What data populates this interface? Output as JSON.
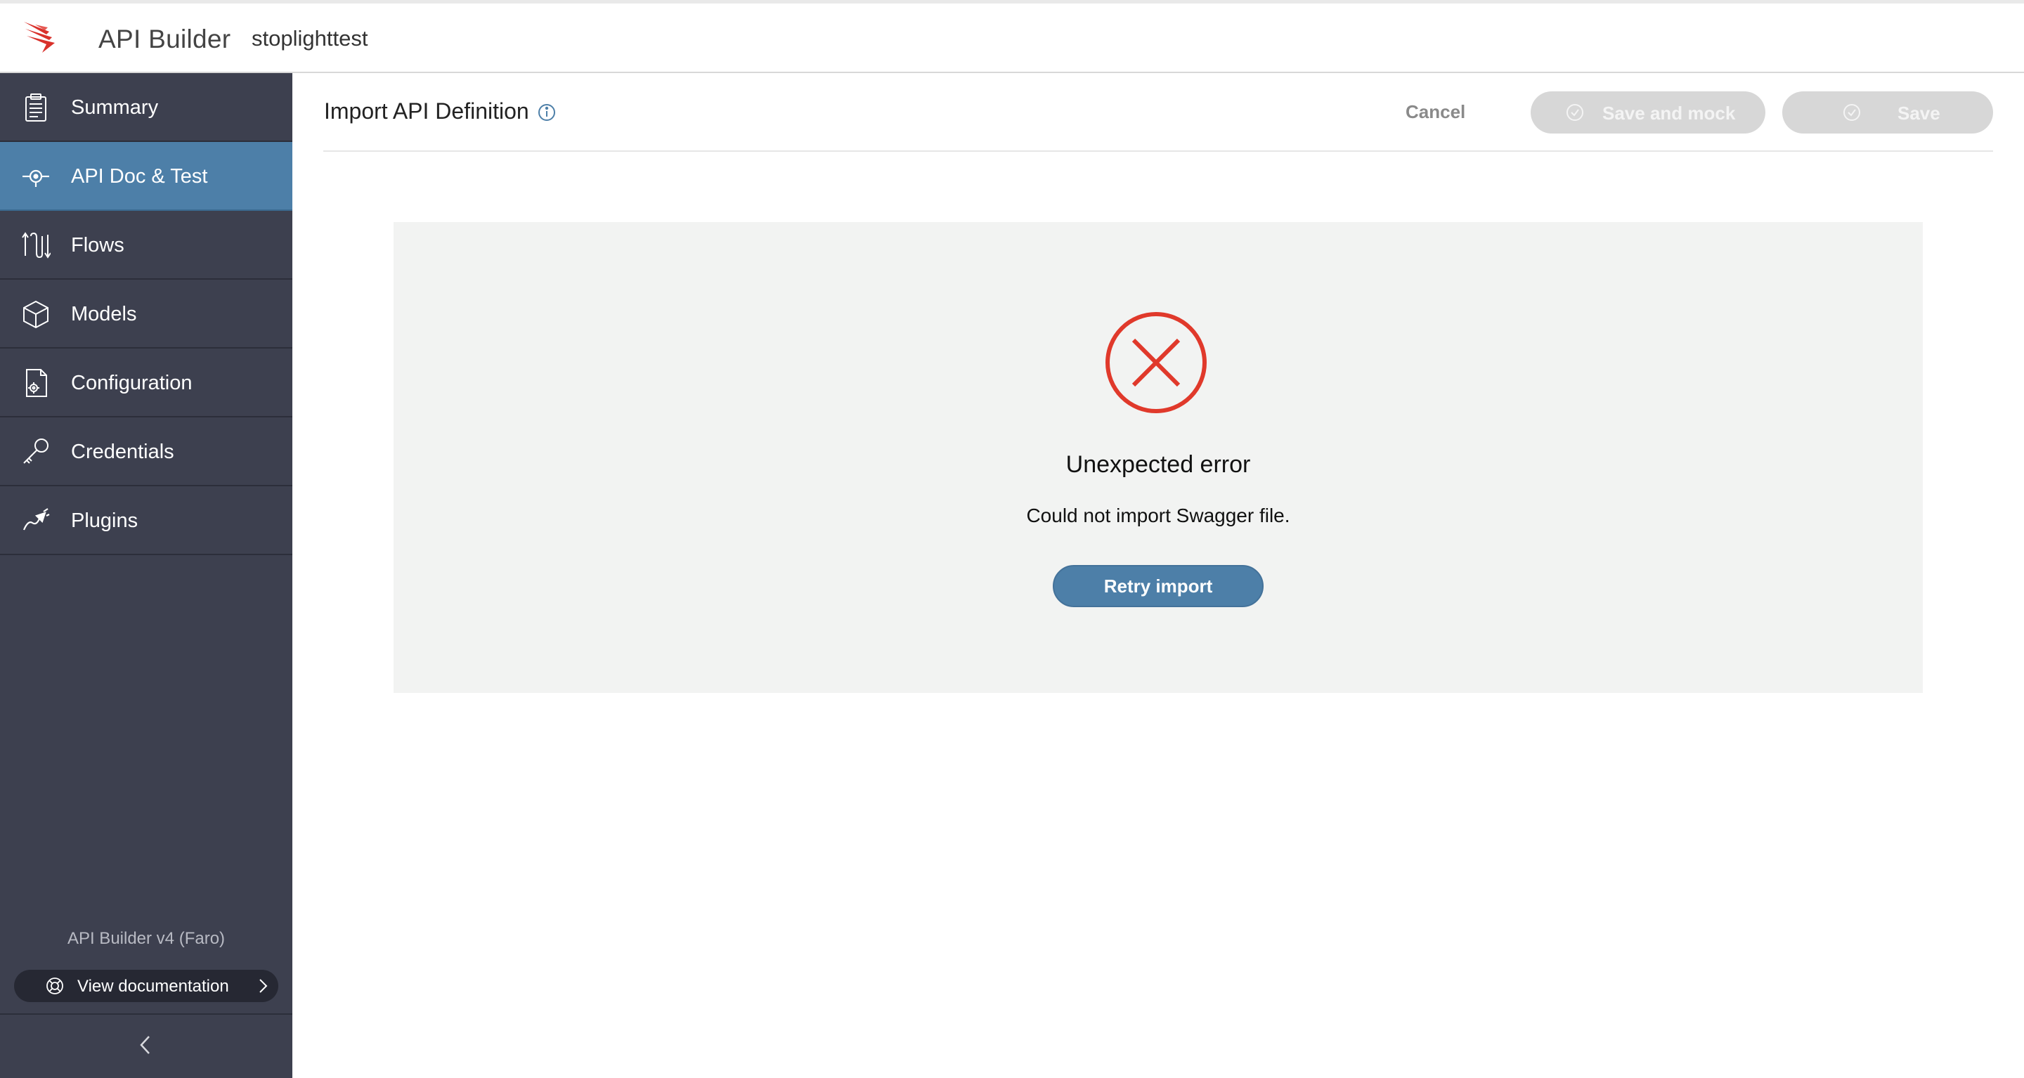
{
  "header": {
    "app_title": "API Builder",
    "project_name": "stoplighttest",
    "logo_icon": "api-builder-logo-icon",
    "brand_color": "#d9312b"
  },
  "sidebar": {
    "background": "#3d404f",
    "active_color": "#4d7fa8",
    "items": [
      {
        "label": "Summary",
        "icon": "clipboard-icon",
        "active": false
      },
      {
        "label": "API Doc & Test",
        "icon": "api-target-icon",
        "active": true
      },
      {
        "label": "Flows",
        "icon": "flows-icon",
        "active": false
      },
      {
        "label": "Models",
        "icon": "cube-icon",
        "active": false
      },
      {
        "label": "Configuration",
        "icon": "config-file-icon",
        "active": false
      },
      {
        "label": "Credentials",
        "icon": "key-icon",
        "active": false
      },
      {
        "label": "Plugins",
        "icon": "plug-icon",
        "active": false
      }
    ],
    "version": "API Builder v4 (Faro)",
    "doc_button": {
      "label": "View documentation",
      "icon": "lifebuoy-icon"
    },
    "collapse_icon": "chevron-left-icon"
  },
  "main": {
    "title": "Import API Definition",
    "info_icon": "info-icon",
    "cancel_label": "Cancel",
    "save_and_mock_label": "Save and mock",
    "save_label": "Save",
    "error": {
      "icon": "error-x-circle-icon",
      "icon_color": "#e0392b",
      "title": "Unexpected error",
      "message": "Could not import Swagger file.",
      "retry_label": "Retry import"
    }
  }
}
